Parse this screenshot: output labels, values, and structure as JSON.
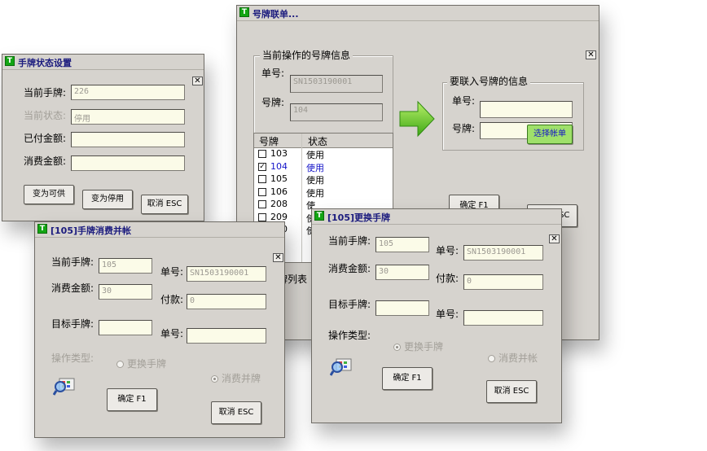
{
  "win_status": {
    "title": "手牌状态设置",
    "close": "✕",
    "current_plate_label": "当前手牌:",
    "current_plate_value": "226",
    "current_state_label": "当前状态:",
    "current_state_value": "停用",
    "paid_label": "已付金额:",
    "paid_value": "",
    "consume_label": "消费金额:",
    "consume_value": "",
    "btn_available": "变为可供",
    "btn_disable": "变为停用",
    "btn_cancel": "取消 ESC"
  },
  "win_link": {
    "title": "号牌联单...",
    "close": "✕",
    "group_current": "当前操作的号牌信息",
    "order_label": "单号:",
    "order_value": "SN1503190001",
    "plate_label": "号牌:",
    "plate_value": "104",
    "group_target": "要联入号牌的信息",
    "target_order_label": "单号:",
    "target_order_value": "",
    "target_plate_label": "号牌:",
    "target_plate_value": "",
    "select_bill_button": "选择帐单",
    "table_headers": [
      "号牌",
      "状态"
    ],
    "table_rows": [
      {
        "plate": "103",
        "status": "使用",
        "checked": false
      },
      {
        "plate": "104",
        "status": "使用",
        "checked": true
      },
      {
        "plate": "105",
        "status": "使用",
        "checked": false
      },
      {
        "plate": "106",
        "status": "使用",
        "checked": false
      },
      {
        "plate": "208",
        "status": "使",
        "checked": false
      },
      {
        "plate": "209",
        "status": "使",
        "checked": false
      },
      {
        "plate": "210",
        "status": "使",
        "checked": false
      }
    ],
    "list_caption": "牌列表",
    "btn_ok": "确定 F1",
    "btn_cancel": "取消 ESC"
  },
  "win_merge": {
    "title": "[105]手牌消费并帐",
    "close": "✕",
    "current_plate_label": "当前手牌:",
    "current_plate_value": "105",
    "order_label": "单号:",
    "order_value": "SN1503190001",
    "consume_label": "消费金额:",
    "consume_value": "30",
    "pay_label": "付款:",
    "pay_value": "0",
    "target_plate_label": "目标手牌:",
    "target_plate_value": "",
    "target_order_label": "单号:",
    "target_order_value": "",
    "op_type_label": "操作类型:",
    "radio_change": "更换手牌",
    "radio_merge": "消费并牌",
    "btn_ok": "确定 F1",
    "btn_cancel": "取消 ESC"
  },
  "win_change": {
    "title": "[105]更换手牌",
    "close": "✕",
    "current_plate_label": "当前手牌:",
    "current_plate_value": "105",
    "order_label": "单号:",
    "order_value": "SN1503190001",
    "consume_label": "消费金额:",
    "consume_value": "30",
    "pay_label": "付款:",
    "pay_value": "0",
    "target_plate_label": "目标手牌:",
    "target_plate_value": "",
    "target_order_label": "单号:",
    "target_order_value": "",
    "op_type_label": "操作类型:",
    "radio_change": "更换手牌",
    "radio_merge": "消费并帐",
    "btn_ok": "确定 F1",
    "btn_cancel": "取消 ESC"
  },
  "colors": {
    "window_bg": "#d6d3ce",
    "input_bg": "#fbfbe8",
    "title_text": "#1b1b7e",
    "link_blue": "#1414c8",
    "arrow_green": "#5fc21d"
  },
  "icons": [
    "app-icon",
    "close-icon",
    "arrow-right-icon",
    "search-icon",
    "checkbox-icon"
  ]
}
